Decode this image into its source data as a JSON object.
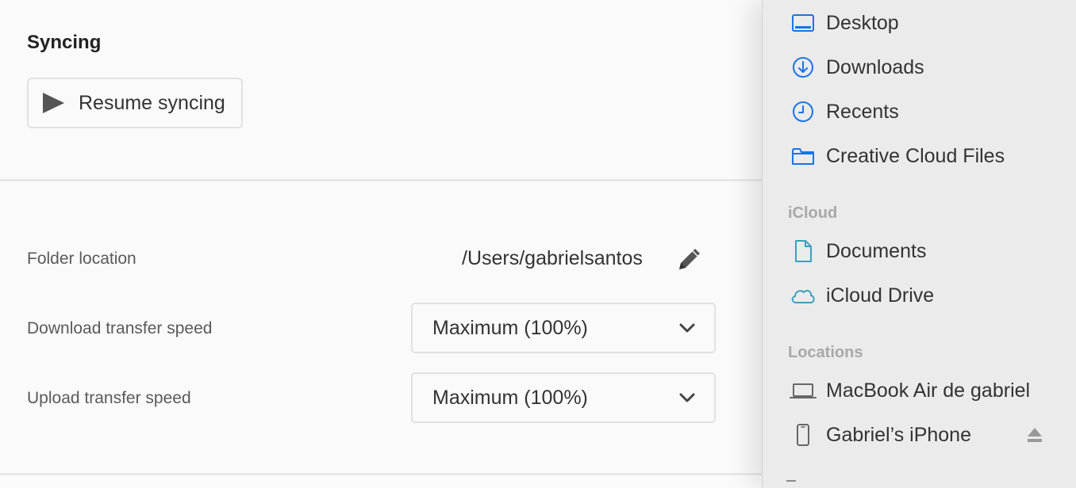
{
  "settings": {
    "section_title": "Syncing",
    "resume_button_label": "Resume syncing",
    "folder_location_label": "Folder location",
    "folder_location_value": "/Users/gabrielsantos",
    "download_speed_label": "Download transfer speed",
    "download_speed_value": "Maximum (100%)",
    "upload_speed_label": "Upload transfer speed",
    "upload_speed_value": "Maximum (100%)"
  },
  "sidebar": {
    "favorites": [
      {
        "label": "Desktop",
        "icon": "desktop-icon"
      },
      {
        "label": "Downloads",
        "icon": "downloads-icon"
      },
      {
        "label": "Recents",
        "icon": "clock-icon"
      },
      {
        "label": "Creative Cloud Files",
        "icon": "folder-icon"
      }
    ],
    "icloud_header": "iCloud",
    "icloud": [
      {
        "label": "Documents",
        "icon": "document-icon"
      },
      {
        "label": "iCloud Drive",
        "icon": "cloud-icon"
      }
    ],
    "locations_header": "Locations",
    "locations": [
      {
        "label": "MacBook Air de gabriel",
        "icon": "laptop-icon"
      },
      {
        "label": "Gabriel’s iPhone",
        "icon": "iphone-icon"
      }
    ]
  },
  "colors": {
    "accent_blue": "#1a73e8",
    "icloud_teal": "#3a9fc0"
  }
}
